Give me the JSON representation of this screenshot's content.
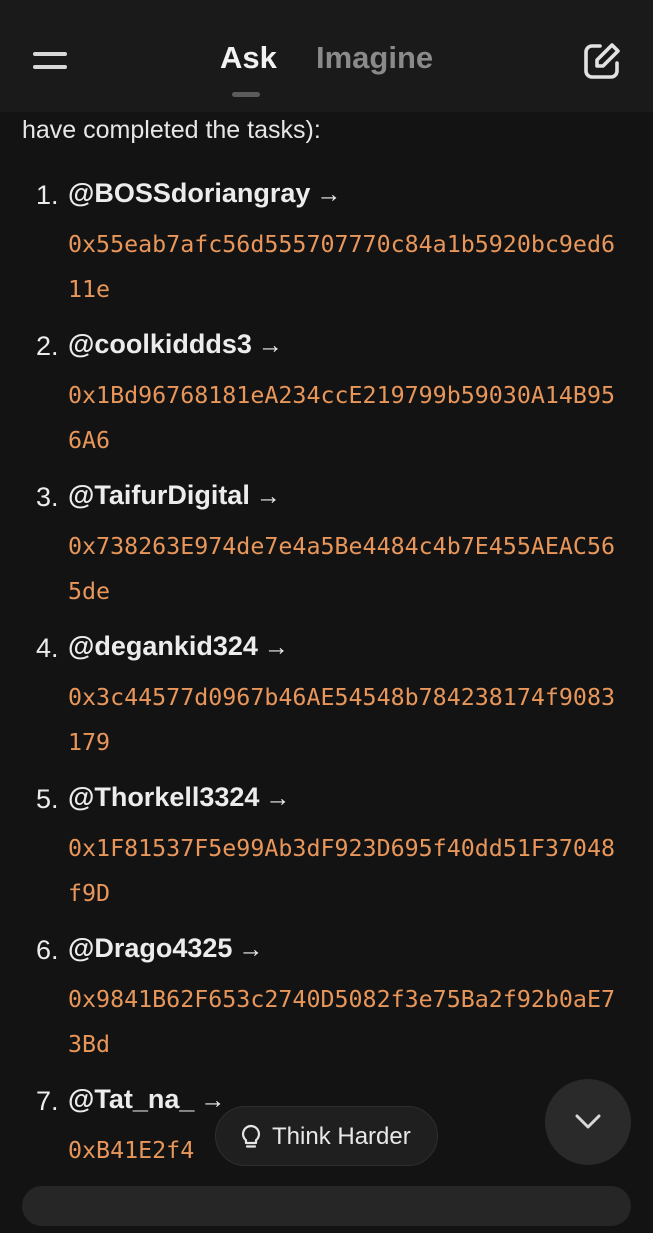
{
  "header": {
    "tabs": [
      {
        "label": "Ask",
        "active": true
      },
      {
        "label": "Imagine",
        "active": false
      }
    ],
    "icons": {
      "menu": "hamburger-menu-icon",
      "new_chat": "edit-square-icon"
    }
  },
  "message": {
    "intro_text": "have completed the tasks):",
    "items": [
      {
        "number": "1.",
        "handle": "@BOSSdoriangray",
        "arrow": "→",
        "address": "0x55eab7afc56d555707770c84a1b5920bc9ed611e"
      },
      {
        "number": "2.",
        "handle": "@coolkiddds3",
        "arrow": "→",
        "address": "0x1Bd96768181eA234ccE219799b59030A14B956A6"
      },
      {
        "number": "3.",
        "handle": "@TaifurDigital",
        "arrow": "→",
        "address": "0x738263E974de7e4a5Be4484c4b7E455AEAC565de"
      },
      {
        "number": "4.",
        "handle": "@degankid324",
        "arrow": "→",
        "address": "0x3c44577d0967b46AE54548b784238174f9083179"
      },
      {
        "number": "5.",
        "handle": "@Thorkell3324",
        "arrow": "→",
        "address": "0x1F81537F5e99Ab3dF923D695f40dd51F37048f9D"
      },
      {
        "number": "6.",
        "handle": "@Drago4325",
        "arrow": "→",
        "address": "0x9841B62F653c2740D5082f3e75Ba2f92b0aE73Bd"
      },
      {
        "number": "7.",
        "handle": "@Tat_na_",
        "arrow": "→",
        "address": "0xB41E2f4"
      }
    ]
  },
  "controls": {
    "think_harder_label": "Think Harder",
    "think_harder_icon": "lightbulb-icon",
    "scroll_down_icon": "chevron-down-icon"
  },
  "colors": {
    "background": "#131313",
    "header_bg": "#1a1a1a",
    "text": "#ececec",
    "address": "#e8965a",
    "inactive_tab": "#8a8a8a"
  }
}
